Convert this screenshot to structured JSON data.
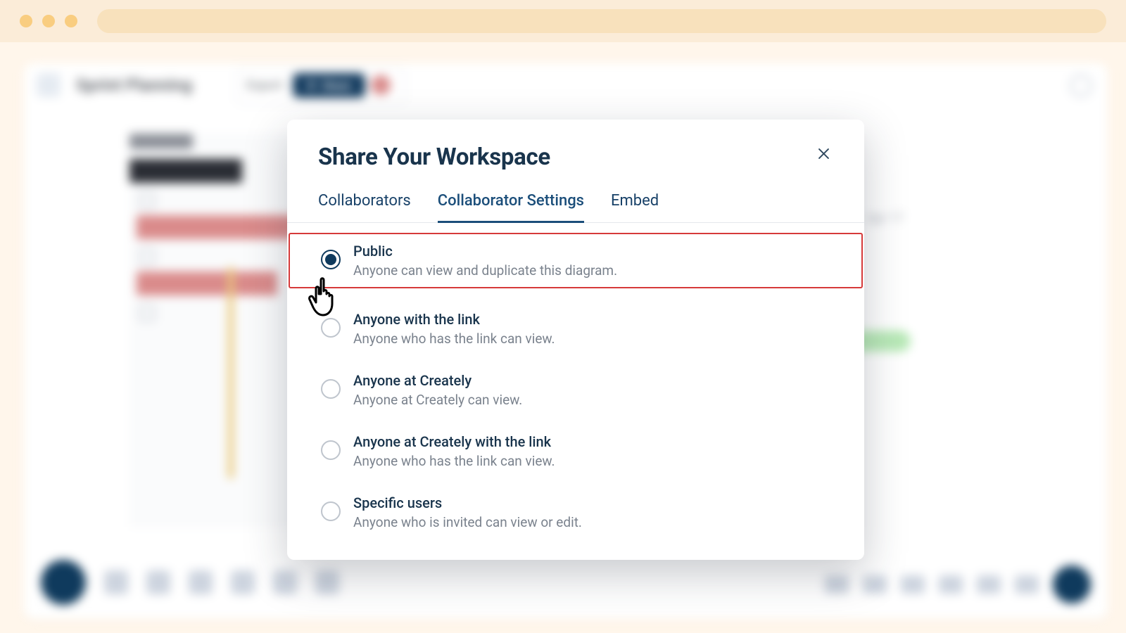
{
  "app": {
    "doc_title": "Sprint Planning",
    "export_label": "Export",
    "share_label": "Share"
  },
  "dialog": {
    "title": "Share Your Workspace",
    "tabs": {
      "collaborators": "Collaborators",
      "settings": "Collaborator Settings",
      "embed": "Embed"
    },
    "active_tab": "settings",
    "options": [
      {
        "label": "Public",
        "desc": "Anyone can view and duplicate this diagram.",
        "selected": true,
        "highlight": true
      },
      {
        "label": "Anyone with the link",
        "desc": "Anyone who has the link can view.",
        "selected": false,
        "highlight": false
      },
      {
        "label": "Anyone at Creately",
        "desc": "Anyone at Creately can view.",
        "selected": false,
        "highlight": false
      },
      {
        "label": "Anyone at Creately with the link",
        "desc": "Anyone who has the link can view.",
        "selected": false,
        "highlight": false
      },
      {
        "label": "Specific users",
        "desc": "Anyone who is invited can view or edit.",
        "selected": false,
        "highlight": false
      }
    ]
  },
  "canvas": {
    "date": "Apr 17"
  }
}
